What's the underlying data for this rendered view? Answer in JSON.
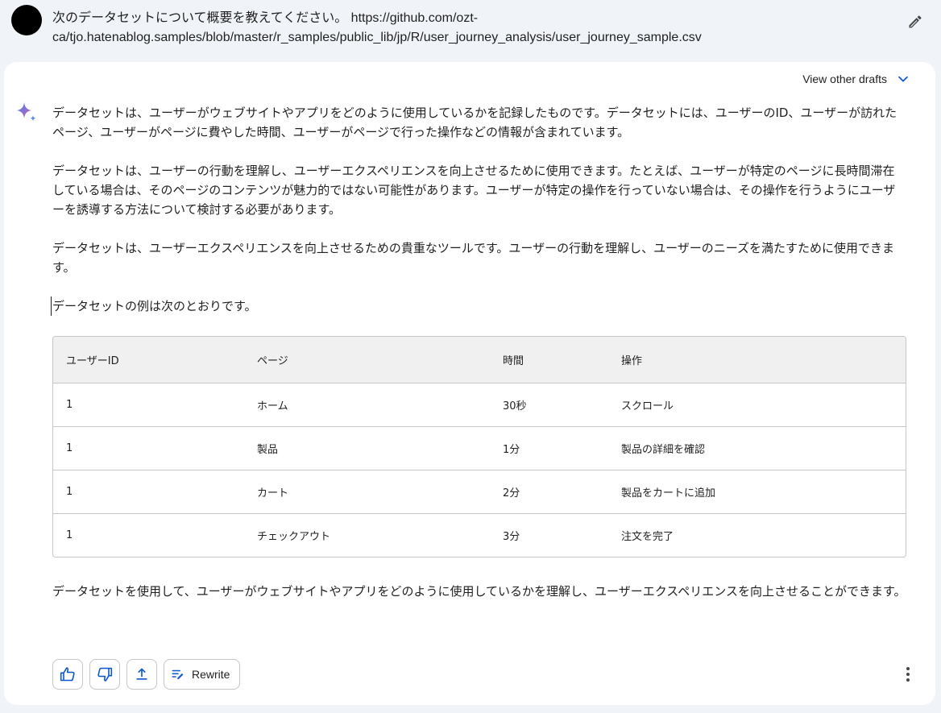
{
  "prompt": {
    "text": "次のデータセットについて概要を教えてください。 https://github.com/ozt-\nca/tjo.hatenablog.samples/blob/master/r_samples/public_lib/jp/R/user_journey_analysis/user_journey_sample.csv",
    "edit_icon": "pencil-icon"
  },
  "response": {
    "drafts_label": "View other drafts",
    "paragraphs": [
      "データセットは、ユーザーがウェブサイトやアプリをどのように使用しているかを記録したものです。データセットには、ユーザーのID、ユーザーが訪れたページ、ユーザーがページに費やした時間、ユーザーがページで行った操作などの情報が含まれています。",
      "データセットは、ユーザーの行動を理解し、ユーザーエクスペリエンスを向上させるために使用できます。たとえば、ユーザーが特定のページに長時間滞在している場合は、そのページのコンテンツが魅力的ではない可能性があります。ユーザーが特定の操作を行っていない場合は、その操作を行うようにユーザーを誘導する方法について検討する必要があります。",
      "データセットは、ユーザーエクスペリエンスを向上させるための貴重なツールです。ユーザーの行動を理解し、ユーザーのニーズを満たすために使用できます。",
      "データセットの例は次のとおりです。"
    ],
    "table": {
      "headers": [
        "ユーザーID",
        "ページ",
        "時間",
        "操作"
      ],
      "rows": [
        [
          "1",
          "ホーム",
          "30秒",
          "スクロール"
        ],
        [
          "1",
          "製品",
          "1分",
          "製品の詳細を確認"
        ],
        [
          "1",
          "カート",
          "2分",
          "製品をカートに追加"
        ],
        [
          "1",
          "チェックアウト",
          "3分",
          "注文を完了"
        ]
      ]
    },
    "summary": "データセットを使用して、ユーザーがウェブサイトやアプリをどのように使用しているかを理解し、ユーザーエクスペリエンスを向上させることができます。"
  },
  "actions": {
    "thumbs_up_icon": "thumbs-up-icon",
    "thumbs_down_icon": "thumbs-down-icon",
    "share_icon": "share-icon",
    "rewrite_label": "Rewrite",
    "more_icon": "more-vertical-icon"
  },
  "colors": {
    "page_background": "#f0f4f9",
    "card_background": "#ffffff",
    "accent_blue": "#0b57d0",
    "border": "#c4c7c5",
    "table_header_bg": "#f0f0f0"
  }
}
